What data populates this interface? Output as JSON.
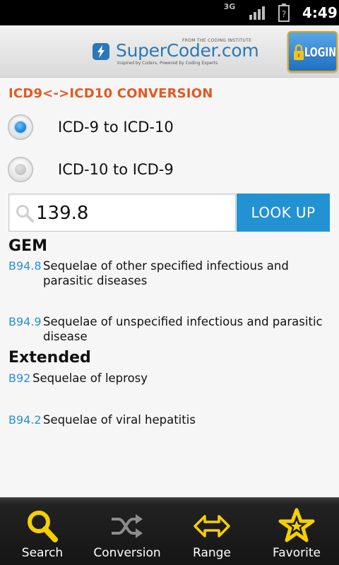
{
  "status_bar": {
    "network": "3G",
    "time": "4:49"
  },
  "header": {
    "logo_top": "FROM THE CODING INSTITUTE",
    "logo_text": "SuperCoder.com",
    "logo_tagline": "Inspired by Coders, Powered by Coding Experts",
    "login_label": "LOGIN"
  },
  "page": {
    "section_title": "ICD9<->ICD10 CONVERSION",
    "options": [
      {
        "label": "ICD-9 to ICD-10",
        "selected": true
      },
      {
        "label": "ICD-10 to ICD-9",
        "selected": false
      }
    ],
    "search": {
      "value": "139.8"
    },
    "lookup_label": "LOOK UP"
  },
  "results": {
    "gem": {
      "heading": "GEM",
      "items": [
        {
          "code": "B94.8",
          "description": "Sequelae of other specified infectious and parasitic diseases"
        },
        {
          "code": "B94.9",
          "description": "Sequelae of unspecified infectious and parasitic disease"
        }
      ]
    },
    "extended": {
      "heading": "Extended",
      "items": [
        {
          "code": "B92",
          "description": "Sequelae of leprosy"
        },
        {
          "code": "B94.2",
          "description": "Sequelae of viral hepatitis"
        }
      ]
    }
  },
  "bottom_nav": [
    {
      "label": "Search",
      "icon": "search-icon",
      "color": "#f4d000"
    },
    {
      "label": "Conversion",
      "icon": "shuffle-icon",
      "color": "#8c8c8c"
    },
    {
      "label": "Range",
      "icon": "double-arrow-icon",
      "color": "#f4d000"
    },
    {
      "label": "Favorite",
      "icon": "star-icon",
      "color": "#f4d000"
    }
  ],
  "colors": {
    "accent_orange": "#e15a22",
    "accent_blue": "#2292d3",
    "code_blue": "#2c8fd2",
    "nav_yellow": "#f4d000"
  }
}
